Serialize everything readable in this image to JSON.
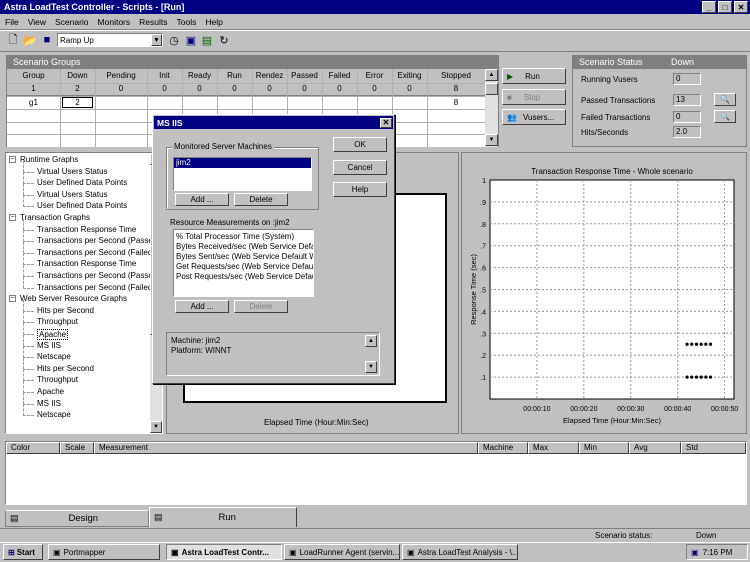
{
  "window": {
    "title": "Astra LoadTest Controller - Scripts - [Run]"
  },
  "menu": [
    "File",
    "View",
    "Scenario",
    "Monitors",
    "Results",
    "Tools",
    "Help"
  ],
  "toolbar": {
    "combo_value": "Ramp Up"
  },
  "scenario_groups": {
    "title": "Scenario Groups",
    "headers": [
      "Group",
      "Down",
      "Pending",
      "Init",
      "Ready",
      "Run",
      "Rendez",
      "Passed",
      "Failed",
      "Error",
      "Exiting",
      "Stopped"
    ],
    "totals": [
      "1",
      "2",
      "0",
      "0",
      "0",
      "0",
      "0",
      "0",
      "0",
      "0",
      "0",
      "8"
    ],
    "row1": [
      "g1",
      "2",
      "",
      "",
      "",
      "",
      "",
      "",
      "",
      "",
      "",
      "8"
    ]
  },
  "run_buttons": {
    "run": "Run",
    "stop": "Stop",
    "vusers": "Vusers..."
  },
  "scenario_status": {
    "title": "Scenario Status",
    "state": "Down",
    "running_vusers_label": "Running Vusers",
    "running_vusers": "0",
    "passed_label": "Passed Transactions",
    "passed": "13",
    "failed_label": "Failed Transactions",
    "failed": "0",
    "hits_label": "Hits/Seconds",
    "hits": "2.0"
  },
  "tree": [
    {
      "label": "Runtime Graphs",
      "level": 0
    },
    {
      "label": "Virtual Users Status",
      "level": 1
    },
    {
      "label": "User Defined Data Points",
      "level": 1
    },
    {
      "label": "Virtual Users Status",
      "level": 1
    },
    {
      "label": "User Defined Data Points",
      "level": 1
    },
    {
      "label": "Transaction Graphs",
      "level": 0
    },
    {
      "label": "Transaction Response Time",
      "level": 1
    },
    {
      "label": "Transactions per Second (Passed)",
      "level": 1
    },
    {
      "label": "Transactions per Second (Failed)",
      "level": 1
    },
    {
      "label": "Transaction Response Time",
      "level": 1
    },
    {
      "label": "Transactions per Second (Passed)",
      "level": 1
    },
    {
      "label": "Transactions per Second (Failed)",
      "level": 1
    },
    {
      "label": "Web Server Resource Graphs",
      "level": 0
    },
    {
      "label": "Hits per Second",
      "level": 1
    },
    {
      "label": "Throughput",
      "level": 1
    },
    {
      "label": "Apache",
      "level": 1
    },
    {
      "label": "MS IIS",
      "level": 1
    },
    {
      "label": "Netscape",
      "level": 1
    },
    {
      "label": "Hits per Second",
      "level": 1
    },
    {
      "label": "Throughput",
      "level": 1
    },
    {
      "label": "Apache",
      "level": 1
    },
    {
      "label": "MS IIS",
      "level": 1
    },
    {
      "label": "Netscape",
      "level": 1
    }
  ],
  "left_graph": {
    "xlabel": "Elapsed Time (Hour:Min:Sec)"
  },
  "chart_data": {
    "type": "scatter",
    "title": "Transaction Response Time - Whole scenario",
    "xlabel": "Elapsed Time (Hour:Min:Sec)",
    "ylabel": "Response Time (sec)",
    "x_ticks": [
      "00:00:10",
      "00:00:20",
      "00:00:30",
      "00:00:40",
      "00:00:50"
    ],
    "y_ticks": [
      "1",
      ".9",
      ".8",
      ".7",
      ".6",
      ".5",
      ".4",
      ".3",
      ".2",
      ".1"
    ],
    "ylim": [
      0,
      1
    ],
    "grid": true,
    "series": [
      {
        "x": [
          "00:00:42",
          "00:00:43",
          "00:00:44",
          "00:00:45",
          "00:00:46",
          "00:00:47"
        ],
        "values": [
          0.25,
          0.25,
          0.25,
          0.25,
          0.25,
          0.25
        ]
      },
      {
        "x": [
          "00:00:42",
          "00:00:43",
          "00:00:44",
          "00:00:45",
          "00:00:46",
          "00:00:47"
        ],
        "values": [
          0.1,
          0.1,
          0.1,
          0.1,
          0.1,
          0.1
        ]
      }
    ]
  },
  "measure_table": {
    "headers": [
      "Color",
      "Scale",
      "Measurement",
      "Machine",
      "Max",
      "Min",
      "Avg",
      "Std"
    ]
  },
  "tabs": {
    "design": "Design",
    "run": "Run"
  },
  "statusbar": {
    "label": "Scenario status:",
    "value": "Down"
  },
  "dialog": {
    "title": "MS IIS",
    "ok": "OK",
    "cancel": "Cancel",
    "help": "Help",
    "monitored_label": "Monitored Server Machines",
    "machines": [
      "jim2"
    ],
    "add": "Add ...",
    "delete": "Delete",
    "resource_label": "Resource Measurements on :jim2",
    "resources": [
      "% Total Processor Time (System)",
      "Bytes Received/sec (Web Service Default Web Site)",
      "Bytes Sent/sec (Web Service Default Web Site)",
      "Get Requests/sec (Web Service Default Web Site)",
      "Post Requests/sec (Web Service Default Web Site)"
    ],
    "add2": "Add ...",
    "delete2": "Delete",
    "machine_info": "Machine: jim2",
    "platform_info": "Platform: WINNT"
  },
  "taskbar": {
    "start": "Start",
    "items": [
      "Portmapper",
      "Astra LoadTest Contr...",
      "LoadRunner Agent  (servin...",
      "Astra LoadTest Analysis - \\..."
    ],
    "clock": "7:16 PM"
  }
}
